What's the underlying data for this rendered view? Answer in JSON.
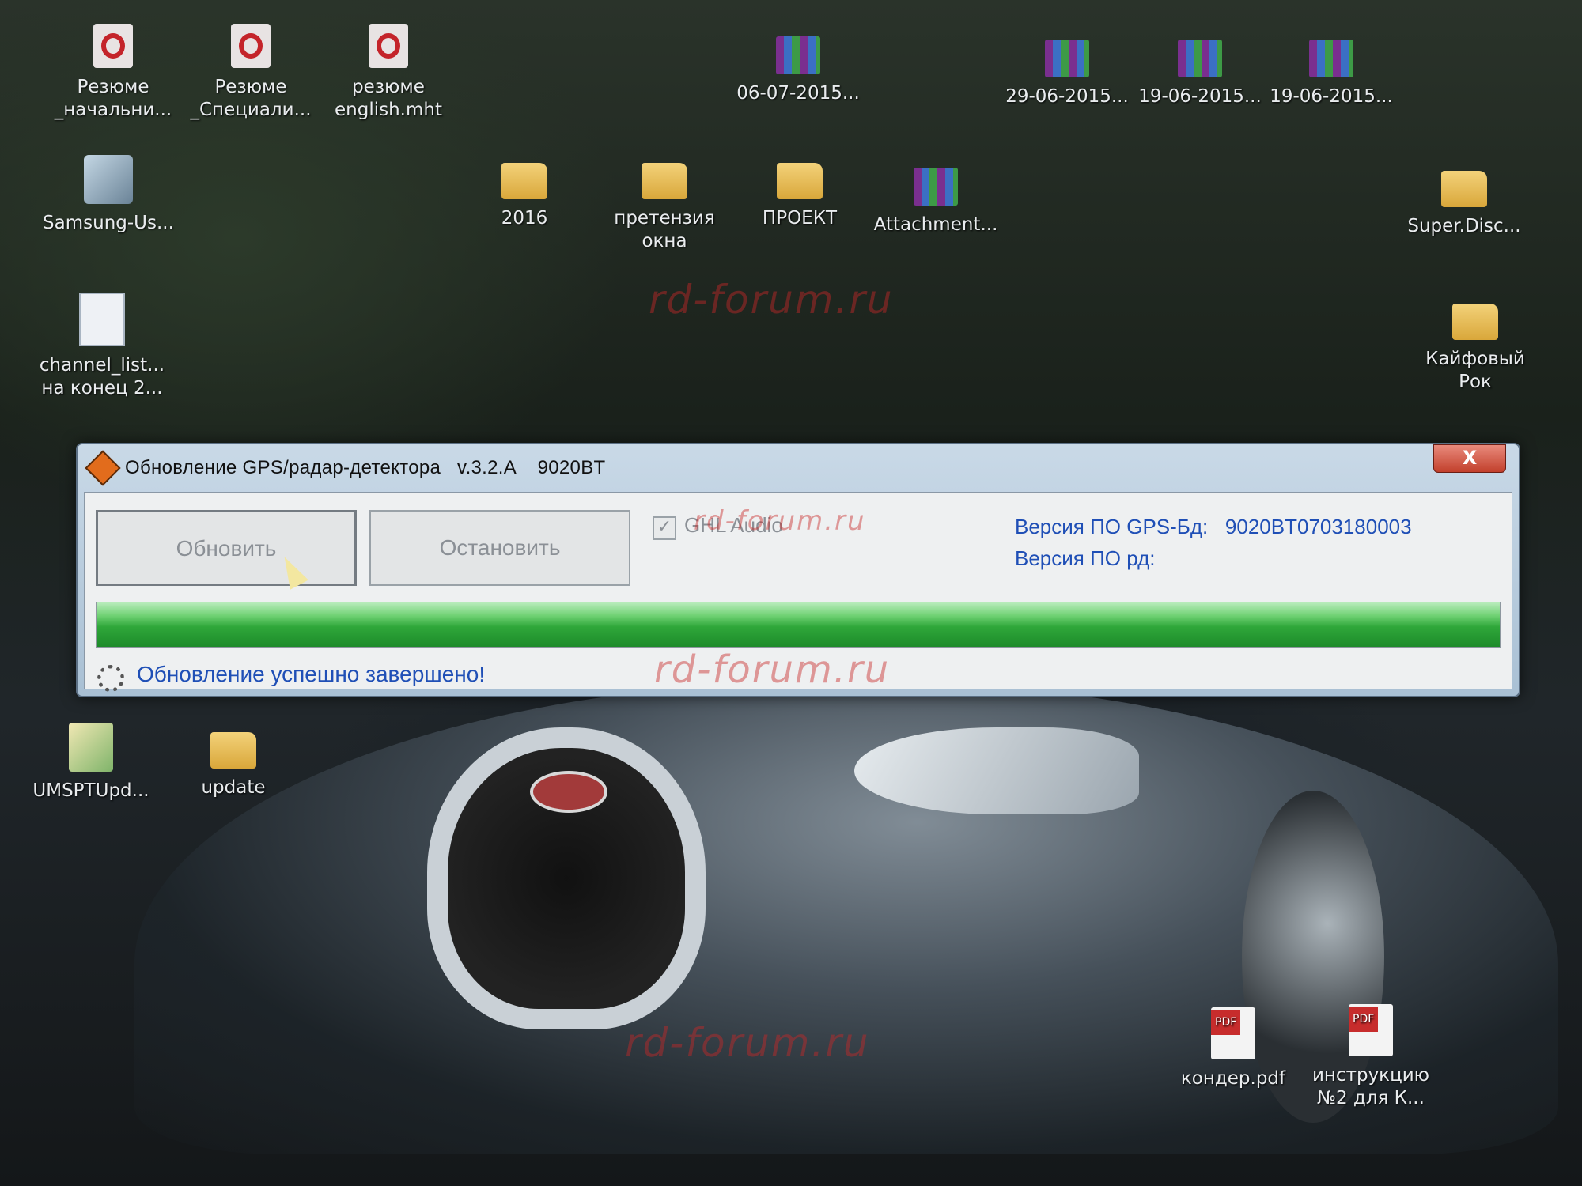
{
  "desktop": {
    "icons": [
      {
        "label": "Резюме _начальни...",
        "type": "opera"
      },
      {
        "label": "Резюме _Специали...",
        "type": "opera"
      },
      {
        "label": "резюме english.mht",
        "type": "opera"
      },
      {
        "label": "06-07-2015...",
        "type": "rar"
      },
      {
        "label": "29-06-2015...",
        "type": "rar"
      },
      {
        "label": "19-06-2015...",
        "type": "rar"
      },
      {
        "label": "19-06-2015...",
        "type": "rar"
      },
      {
        "label": "Samsung-Us...",
        "type": "setup"
      },
      {
        "label": "2016",
        "type": "folder"
      },
      {
        "label": "претензия окна",
        "type": "folder"
      },
      {
        "label": "ПРОЕКТ",
        "type": "folder"
      },
      {
        "label": "Attachment...",
        "type": "rar"
      },
      {
        "label": "Super.Disc...",
        "type": "folder"
      },
      {
        "label": "channel_list... на конец 2...",
        "type": "doc"
      },
      {
        "label": "Кайфовый Рок",
        "type": "folder"
      },
      {
        "label": "UMSPTUpd...",
        "type": "pkg"
      },
      {
        "label": "update",
        "type": "folder"
      },
      {
        "label": "кондер.pdf",
        "type": "pdf"
      },
      {
        "label": "инструкцию №2 для К...",
        "type": "pdf"
      }
    ],
    "watermark": "rd-forum.ru"
  },
  "window": {
    "title": "Обновление GPS/радар-детектора   v.3.2.A    9020BT",
    "close_label": "X",
    "buttons": {
      "update": "Обновить",
      "stop": "Остановить"
    },
    "checkbox": {
      "label": "GHL Audio",
      "checked": true,
      "mark": "✓"
    },
    "info": {
      "gps_db_version": "Версия ПО GPS-Бд:   9020BT0703180003",
      "rd_version": "Версия ПО рд:"
    },
    "progress": 1.0,
    "status": "Обновление успешно завершено!"
  }
}
